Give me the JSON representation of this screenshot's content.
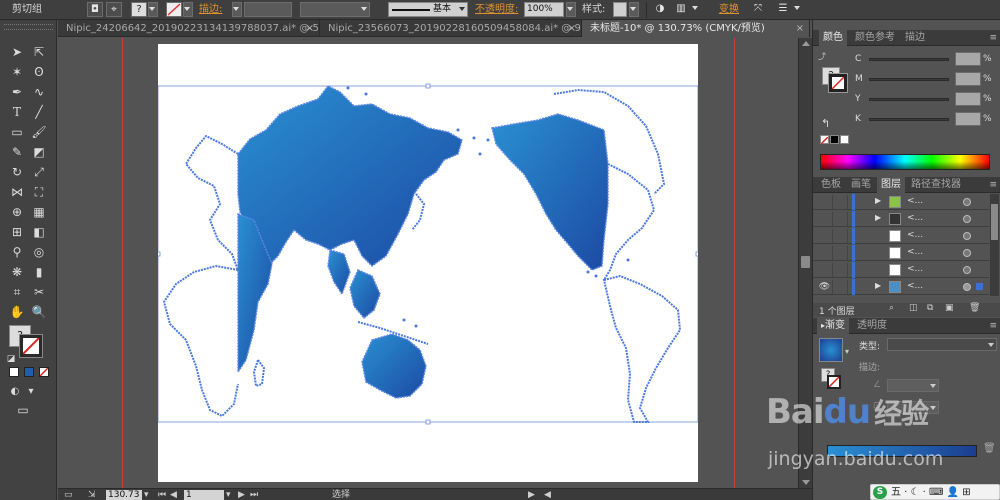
{
  "control_bar": {
    "group_label": "剪切组",
    "stroke_label": "描边:",
    "stroke_style_label": "基本",
    "opacity_label": "不透明度:",
    "opacity_value": "100%",
    "style_label": "样式:",
    "transform_label": "变换",
    "question_mark": "?"
  },
  "document_tabs": [
    {
      "label": "Nipic_24206642_20190223134139788037.ai* @ 50...",
      "close": "×"
    },
    {
      "label": "Nipic_23566073_20190228160509458084.ai* @ 98...",
      "close": "×"
    },
    {
      "label": "未标题-10* @ 130.73% (CMYK/预览)",
      "close": "×",
      "active": true
    }
  ],
  "tools": {
    "question": "?"
  },
  "status_bar": {
    "zoom_value": "130.73",
    "page_value": "1",
    "mode_label": "选择"
  },
  "color_panel": {
    "tabs": [
      "颜色",
      "颜色参考",
      "描边"
    ],
    "channels": [
      {
        "name": "C",
        "unit": "%"
      },
      {
        "name": "M",
        "unit": "%"
      },
      {
        "name": "Y",
        "unit": "%"
      },
      {
        "name": "K",
        "unit": "%"
      }
    ]
  },
  "layers_panel": {
    "tabs": [
      "色板",
      "画笔",
      "图层",
      "路径查找器"
    ],
    "rows": [
      {
        "name": "<...",
        "expanded": true
      },
      {
        "name": "<...",
        "expanded": true
      },
      {
        "name": "<...",
        "expanded": false
      },
      {
        "name": "<...",
        "expanded": false
      },
      {
        "name": "<...",
        "expanded": false
      },
      {
        "name": "<...",
        "expanded": true,
        "visible": true
      }
    ],
    "count_label": "1 个图层"
  },
  "gradient_panel": {
    "tabs": [
      "渐变",
      "透明度"
    ],
    "type_label": "类型:",
    "stroke_label": "描边:",
    "position_label": "位"
  },
  "watermark": {
    "logo": "Bai",
    "logo_du": "du",
    "logo_cn": "经验",
    "url": "jingyan.baidu.com"
  },
  "ime_bar": {
    "logo": "S",
    "text": "五 · ☾ · ⌨ 👤 ⊞"
  },
  "colors": {
    "map_fill_start": "#2a8fd0",
    "map_fill_end": "#1f4fa8",
    "map_outline": "#4a78e0",
    "guide_red": "#c8403a",
    "stroke_orange": "#e0922f"
  }
}
